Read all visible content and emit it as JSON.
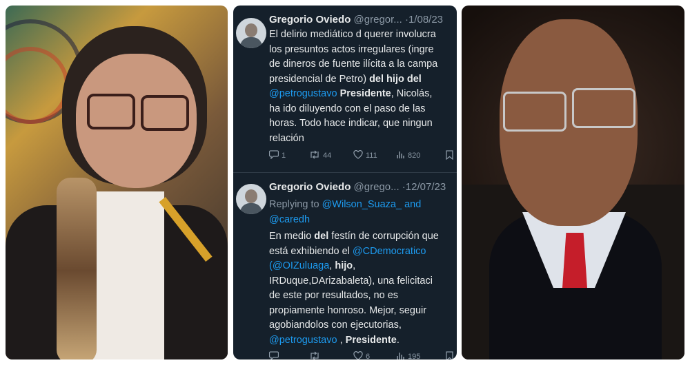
{
  "tweets": [
    {
      "name": "Gregorio Oviedo",
      "handle": "@gregor...",
      "separator": "·",
      "date": "1/08/23",
      "lines": [
        [
          {
            "t": "El delirio mediático d querer involucra"
          }
        ],
        [
          {
            "t": "los presuntos actos irregulares (ingre"
          }
        ],
        [
          {
            "t": "de dineros de fuente ilícita a la campa"
          }
        ],
        [
          {
            "t": "presidencial de Petro) "
          },
          {
            "t": "del hijo del",
            "s": "b"
          }
        ],
        [
          {
            "t": "@petrogustavo",
            "s": "link"
          },
          {
            "t": " "
          },
          {
            "t": "Presidente",
            "s": "b"
          },
          {
            "t": ", Nicolás,"
          }
        ],
        [
          {
            "t": "ha ido diluyendo con el paso de las"
          }
        ],
        [
          {
            "t": "horas. Todo hace indicar, que ningun"
          }
        ],
        [
          {
            "t": "relación"
          }
        ]
      ],
      "actions": {
        "reply": "1",
        "retweet": "44",
        "like": "111",
        "views": "820"
      }
    },
    {
      "name": "Gregorio Oviedo",
      "handle": "@grego...",
      "separator": "·",
      "date": "12/07/23",
      "reply_lines": [
        [
          {
            "t": "Replying to "
          },
          {
            "t": "@Wilson_Suaza_",
            "s": "link"
          },
          {
            "t": " "
          },
          {
            "t": "and",
            "s": "link"
          }
        ],
        [
          {
            "t": "@caredh",
            "s": "link"
          }
        ]
      ],
      "lines": [
        [
          {
            "t": "En medio "
          },
          {
            "t": "del",
            "s": "b"
          },
          {
            "t": " festín de corrupción que"
          }
        ],
        [
          {
            "t": "está exhibiendo el "
          },
          {
            "t": "@CDemocratico",
            "s": "link"
          }
        ],
        [
          {
            "t": "(",
            "s": "link"
          },
          {
            "t": "@OIZuluaga",
            "s": "link"
          },
          {
            "t": ", "
          },
          {
            "t": "hijo",
            "s": "b"
          },
          {
            "t": ","
          }
        ],
        [
          {
            "t": "IRDuque,DArizabaleta), una felicitaci"
          }
        ],
        [
          {
            "t": "de este por resultados, no es"
          }
        ],
        [
          {
            "t": "propiamente honroso. Mejor, seguir"
          }
        ],
        [
          {
            "t": "agobiandolos con ejecutorias,"
          }
        ],
        [
          {
            "t": "@petrogustavo",
            "s": "link"
          },
          {
            "t": " , "
          },
          {
            "t": "Presidente",
            "s": "b"
          },
          {
            "t": "."
          }
        ]
      ],
      "actions": {
        "reply": "",
        "retweet": "",
        "like": "6",
        "views": "195"
      }
    }
  ],
  "icons": {
    "reply": "reply-icon",
    "retweet": "retweet-icon",
    "like": "like-icon",
    "views": "views-icon",
    "bookmark": "bookmark-icon"
  },
  "colors": {
    "background": "#15202b",
    "text": "#e7e9ea",
    "muted": "#8b98a5",
    "link": "#1d9bf0"
  }
}
